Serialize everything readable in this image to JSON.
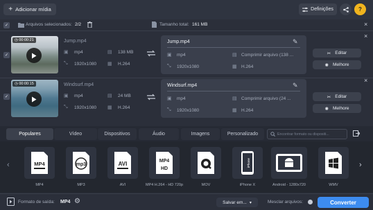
{
  "toolbar": {
    "add_media_label": "Adicionar mídia",
    "settings_label": "Definições"
  },
  "selection": {
    "selected_label": "Arquivos selecionados:",
    "selected_count": "2/2",
    "total_label": "Tamanho total:",
    "total_value": "161 MB"
  },
  "files": [
    {
      "duration": "00:00:21",
      "name": "Jump.mp4",
      "format": "mp4",
      "size": "138 MB",
      "resolution": "1920x1080",
      "codec": "H.264",
      "output_name": "Jump.mp4",
      "output_format": "mp4",
      "output_compress": "Comprimir arquivo (138 ...",
      "output_resolution": "1920x1080",
      "output_codec": "H.264",
      "edit_label": "Editar",
      "enhance_label": "Melhore"
    },
    {
      "duration": "00:00:15",
      "name": "Windsurf.mp4",
      "format": "mp4",
      "size": "24 MB",
      "resolution": "1920x1080",
      "codec": "H.264",
      "output_name": "Windsurf.mp4",
      "output_format": "mp4",
      "output_compress": "Comprimir arquivo (24 ...",
      "output_resolution": "1920x1080",
      "output_codec": "H.264",
      "edit_label": "Editar",
      "enhance_label": "Melhore"
    }
  ],
  "tabs": [
    "Populares",
    "Vídeo",
    "Dispositivos",
    "Áudio",
    "Imagens",
    "Personalizado"
  ],
  "active_tab": "Populares",
  "search_placeholder": "Encontrar formato ou dispositi...",
  "formats": [
    {
      "label": "MP4",
      "icon": "mp4-icon"
    },
    {
      "label": "MP3",
      "icon": "mp3-icon"
    },
    {
      "label": "AVI",
      "icon": "avi-icon"
    },
    {
      "label": "MP4 H.264 - HD 720p",
      "icon": "mp4-hd-icon"
    },
    {
      "label": "MOV",
      "icon": "mov-icon"
    },
    {
      "label": "iPhone X",
      "icon": "iphone-icon"
    },
    {
      "label": "Android - 1280x720",
      "icon": "android-icon"
    },
    {
      "label": "WMV",
      "icon": "wmv-icon"
    }
  ],
  "bottom": {
    "output_format_label": "Formato de saída:",
    "output_format_value": "MP4",
    "save_label": "Salvar em...",
    "merge_label": "Mesclar arquivos:",
    "convert_label": "Converter"
  },
  "colors": {
    "accent": "#3d8cf0",
    "background": "#2b2f3a"
  }
}
